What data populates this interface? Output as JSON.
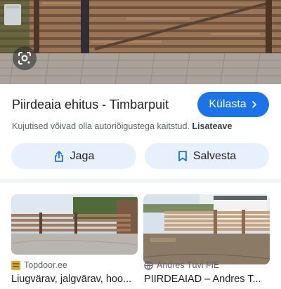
{
  "result": {
    "title": "Piirdeaia ehitus - Timbarpuit",
    "visit_label": "Külasta",
    "copyright_text": "Kujutised võivad olla autoriõigustega kaitstud.",
    "learn_more_label": "Lisateave",
    "share_label": "Jaga",
    "save_label": "Salvesta"
  },
  "related": [
    {
      "source": "Topdoor.ee",
      "title": "Liugvärav, jalgvärav, hoo..."
    },
    {
      "source": "Andres Tüvi FIE",
      "title": "PIIRDEAIAD – Andres T..."
    }
  ],
  "colors": {
    "accent": "#1a73e8",
    "tonal_button": "#e8f0fe",
    "text": "#1f1f1f",
    "secondary": "#5f6368"
  },
  "icons": [
    "google-lens-icon",
    "chevron-right-icon",
    "share-icon",
    "bookmark-icon",
    "topdoor-favicon",
    "globe-icon"
  ]
}
